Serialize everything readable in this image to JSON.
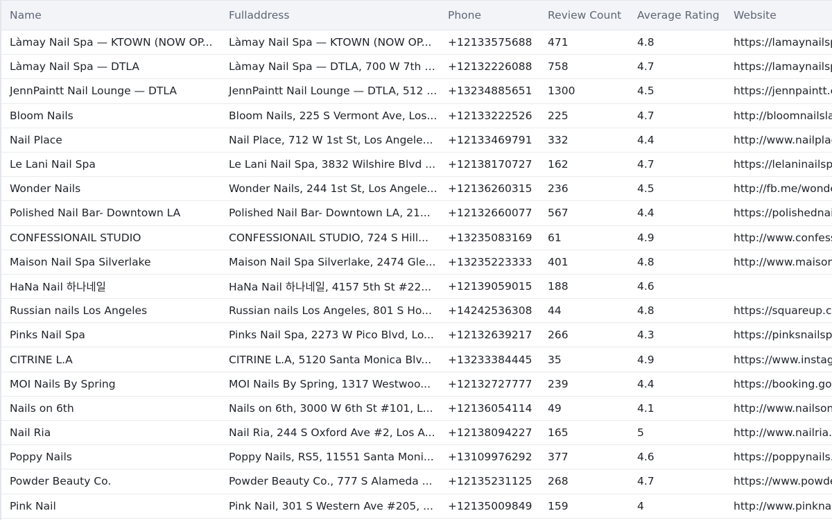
{
  "columns": {
    "name": "Name",
    "fulladdress": "Fulladdress",
    "phone": "Phone",
    "review_count": "Review Count",
    "average_rating": "Average Rating",
    "website": "Website"
  },
  "rows": [
    {
      "name": "Làmay Nail Spa — KTOWN (NOW OP...",
      "address": "Làmay Nail Spa — KTOWN (NOW OP...",
      "phone": "+12133575688",
      "reviews": "471",
      "rating": "4.8",
      "website": "https://lamaynailspa"
    },
    {
      "name": "Làmay Nail Spa — DTLA",
      "address": "Làmay Nail Spa — DTLA, 700 W 7th S...",
      "phone": "+12132226088",
      "reviews": "758",
      "rating": "4.7",
      "website": "https://lamaynailspa"
    },
    {
      "name": "JennPaintt Nail Lounge — DTLA",
      "address": "JennPaintt Nail Lounge — DTLA, 512 ...",
      "phone": "+13234885651",
      "reviews": "1300",
      "rating": "4.5",
      "website": "https://jennpaintt.co"
    },
    {
      "name": "Bloom Nails",
      "address": "Bloom Nails, 225 S Vermont Ave, Los...",
      "phone": "+12133222526",
      "reviews": "225",
      "rating": "4.7",
      "website": "http://bloomnailsla."
    },
    {
      "name": "Nail Place",
      "address": "Nail Place, 712 W 1st St, Los Angele...",
      "phone": "+12133469791",
      "reviews": "332",
      "rating": "4.4",
      "website": "http://www.nailplace"
    },
    {
      "name": "Le Lani Nail Spa",
      "address": "Le Lani Nail Spa, 3832 Wilshire Blvd ...",
      "phone": "+12138170727",
      "reviews": "162",
      "rating": "4.7",
      "website": "https://lelaninailspa"
    },
    {
      "name": "Wonder Nails",
      "address": "Wonder Nails, 244 1st St, Los Angele...",
      "phone": "+12136260315",
      "reviews": "236",
      "rating": "4.5",
      "website": "http://fb.me/wonder"
    },
    {
      "name": "Polished Nail Bar- Downtown LA",
      "address": "Polished Nail Bar- Downtown LA, 21...",
      "phone": "+12132660077",
      "reviews": "567",
      "rating": "4.4",
      "website": "https://polishednail"
    },
    {
      "name": "CONFESSIONAIL STUDIO",
      "address": "CONFESSIONAIL STUDIO, 724 S Hill...",
      "phone": "+13235083169",
      "reviews": "61",
      "rating": "4.9",
      "website": "http://www.confessi"
    },
    {
      "name": "Maison Nail Spa Silverlake",
      "address": "Maison Nail Spa Silverlake, 2474 Gle...",
      "phone": "+13235223333",
      "reviews": "401",
      "rating": "4.8",
      "website": "http://www.maisonn"
    },
    {
      "name": "HaNa Nail 하나네일",
      "address": "HaNa Nail 하나네일, 4157 5th St #22...",
      "phone": "+12139059015",
      "reviews": "188",
      "rating": "4.6",
      "website": ""
    },
    {
      "name": "Russian nails Los Angeles",
      "address": "Russian nails Los Angeles, 801 S Ho...",
      "phone": "+14242536308",
      "reviews": "44",
      "rating": "4.8",
      "website": "https://squareup.co"
    },
    {
      "name": "Pinks Nail Spa",
      "address": "Pinks Nail Spa, 2273 W Pico Blvd, Lo...",
      "phone": "+12132639217",
      "reviews": "266",
      "rating": "4.3",
      "website": "https://pinksnailspa"
    },
    {
      "name": "CITRINE L.A",
      "address": "CITRINE L.A, 5120 Santa Monica Blv...",
      "phone": "+13233384445",
      "reviews": "35",
      "rating": "4.9",
      "website": "https://www.instagr"
    },
    {
      "name": "MOI Nails By Spring",
      "address": "MOI Nails By Spring, 1317 Westwoo...",
      "phone": "+12132727777",
      "reviews": "239",
      "rating": "4.4",
      "website": "https://booking.goo"
    },
    {
      "name": "Nails on 6th",
      "address": "Nails on 6th, 3000 W 6th St #101, L...",
      "phone": "+12136054114",
      "reviews": "49",
      "rating": "4.1",
      "website": "http://www.nailsons"
    },
    {
      "name": "Nail Ria",
      "address": "Nail Ria, 244 S Oxford Ave #2, Los A...",
      "phone": "+12138094227",
      "reviews": "165",
      "rating": "5",
      "website": "http://www.nailria.c"
    },
    {
      "name": "Poppy Nails",
      "address": "Poppy Nails, RS5, 11551 Santa Moni...",
      "phone": "+13109976292",
      "reviews": "377",
      "rating": "4.6",
      "website": "https://poppynails.c"
    },
    {
      "name": "Powder Beauty Co.",
      "address": "Powder Beauty Co., 777 S Alameda ...",
      "phone": "+12135231125",
      "reviews": "268",
      "rating": "4.7",
      "website": "https://www.powde"
    },
    {
      "name": "Pink Nail",
      "address": "Pink Nail, 301 S Western Ave #205, ...",
      "phone": "+12135009849",
      "reviews": "159",
      "rating": "4",
      "website": "http://www.pinknail"
    }
  ]
}
